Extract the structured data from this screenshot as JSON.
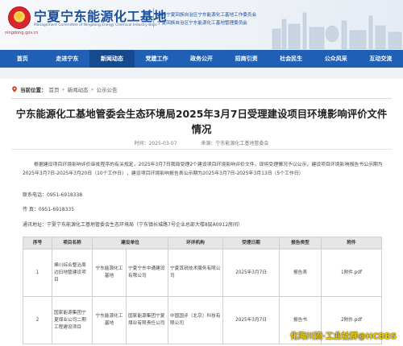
{
  "header": {
    "site_name": "宁夏宁东能源化工基地",
    "site_en": "Management Committee of Ningdong Energy Chemical Industry Base",
    "site_url": "ningdong.gov.cn",
    "sub_line1": "中共宁夏回族自治区宁东能源化工基地工作委员会",
    "sub_line2": "宁夏回族自治区宁东能源化工基地管理委员会"
  },
  "nav": {
    "items": [
      "首页",
      "走进宁东",
      "新闻动态",
      "党建工作",
      "政务公开",
      "招商引资",
      "社会民生",
      "公众风采",
      "互动交流"
    ],
    "active_index": 2
  },
  "breadcrumb": {
    "current_label": "当前位置：",
    "items": [
      "首页",
      "新闻动态",
      "公示公告"
    ]
  },
  "article": {
    "title": "宁东能源化工基地管委会生态环境局2025年3月7日受理建设项目环境影响评价文件情况",
    "date": "时间：2025-03-07",
    "source": "来源：宁东能源化工基地管委会",
    "paragraph": "根据建设项目环境影响评价审批程序的有关规定，2025年3月7日我局受理2个建设项目环境影响评价文件，现将受理情况予以公示，建设项目环境影响报告书公示期为2025年3月7日-2025年3月20日（10个工作日），建设项目环境影响报告表公示期为2025年3月7日-2025年3月13日（5个工作日）",
    "phone": "联系电话：0951-6918338",
    "fax": "传    真：0951-6918335",
    "address": "通讯地址：宁夏宁东能源化工基地管委会生态环境局（宁东镇长城路7号企业总部大楼8层A0912房间）"
  },
  "table": {
    "headers": [
      "序号",
      "项目名称",
      "建设单位",
      "环评机构",
      "受理日期",
      "报告类型",
      "附件"
    ],
    "rows": [
      [
        "1",
        "烯川综合整治周边旧地管建设项目",
        "宁东能源化工基地",
        "宁夏宁东中通建设有限公司",
        "宁夏其锐技术服务有限公司",
        "2025年3月7日",
        "报告表",
        "1附件.pdf"
      ],
      [
        "2",
        "国家能源集团宁夏煤业公司二期工程建设项目",
        "宁东能源化工基地",
        "国家能源集团宁夏煤业有限责任公司",
        "中国国评（北京）科技有限公司",
        "2025年3月7日",
        "报告书",
        "2附件.pdf"
      ]
    ]
  },
  "watermark": "化海川流·工业社群@HCBBS",
  "colors": {
    "nav_bg": "#1f5fb5",
    "nav_active": "#164a8f",
    "brand": "#1a4f9c"
  }
}
